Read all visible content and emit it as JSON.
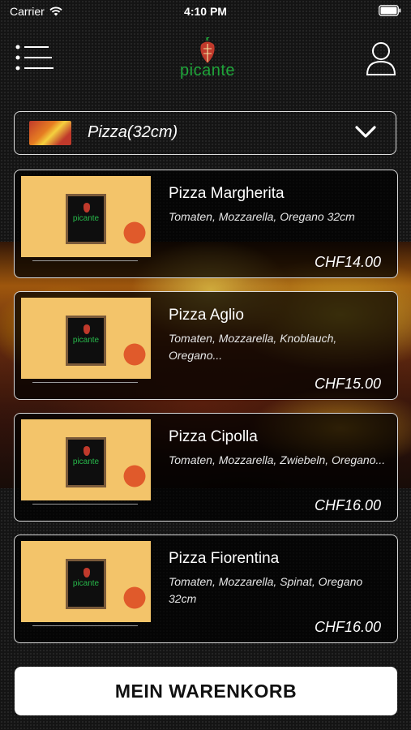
{
  "status_bar": {
    "carrier": "Carrier",
    "time": "4:10 PM"
  },
  "header": {
    "logo_text": "picante",
    "logo_board_text": "picante"
  },
  "category": {
    "label": "Pizza(32cm)"
  },
  "products": [
    {
      "name": "Pizza Margherita",
      "description": "Tomaten, Mozzarella, Oregano 32cm",
      "price": "CHF14.00"
    },
    {
      "name": "Pizza Aglio",
      "description": "Tomaten, Mozzarella, Knoblauch, Oregano...",
      "price": "CHF15.00"
    },
    {
      "name": "Pizza Cipolla",
      "description": "Tomaten, Mozzarella, Zwiebeln, Oregano...",
      "price": "CHF16.00"
    },
    {
      "name": "Pizza Fiorentina",
      "description": "Tomaten, Mozzarella, Spinat, Oregano 32cm",
      "price": "CHF16.00"
    }
  ],
  "cart": {
    "label": "MEIN WARENKORB"
  },
  "colors": {
    "brand_green": "#1fa53a",
    "background": "#141414",
    "accent_white": "#ffffff"
  },
  "icons": [
    "wifi-icon",
    "battery-icon",
    "menu-icon",
    "profile-icon",
    "chevron-down-icon"
  ]
}
